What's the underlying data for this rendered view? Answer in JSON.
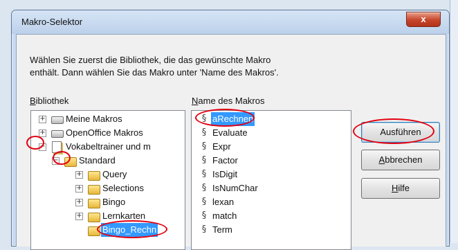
{
  "window": {
    "title": "Makro-Selektor",
    "close_glyph": "x",
    "intro_line1": "Wählen Sie zuerst die Bibliothek, die das gewünschte Makro",
    "intro_line2": "enthält. Dann wählen Sie das Makro unter 'Name des Makros'."
  },
  "library": {
    "label_key": "B",
    "label_rest": "ibliothek",
    "items": [
      {
        "label": "Meine Makros",
        "expander": "+",
        "icon": "drive-icon"
      },
      {
        "label": "OpenOffice Makros",
        "expander": "+",
        "icon": "drive-icon"
      },
      {
        "label": "Vokabeltrainer und m",
        "expander": "−",
        "icon": "document-icon"
      },
      {
        "label": "Standard",
        "expander": "−",
        "icon": "folder-icon"
      },
      {
        "label": "Query",
        "expander": "+",
        "icon": "folder-icon"
      },
      {
        "label": "Selections",
        "expander": "+",
        "icon": "folder-icon"
      },
      {
        "label": "Bingo",
        "expander": "+",
        "icon": "folder-icon"
      },
      {
        "label": "Lernkarten",
        "expander": "+",
        "icon": "folder-icon"
      },
      {
        "label": "Bingo_Rechn",
        "icon": "folder-icon",
        "selected": true
      }
    ]
  },
  "macros": {
    "label_key": "N",
    "label_rest": "ame des Makros",
    "items": [
      {
        "label": "aRechnen",
        "selected": true
      },
      {
        "label": "Evaluate"
      },
      {
        "label": "Expr"
      },
      {
        "label": "Factor"
      },
      {
        "label": "IsDigit"
      },
      {
        "label": "IsNumChar"
      },
      {
        "label": "lexan"
      },
      {
        "label": "match"
      },
      {
        "label": "Term"
      }
    ],
    "icon": "macro-icon"
  },
  "buttons": {
    "run": "Ausführen",
    "cancel_key": "A",
    "cancel_rest": "bbrechen",
    "help_key": "H",
    "help_rest": "ilfe"
  },
  "colors": {
    "selection": "#3399ff",
    "annotation": "#e3000f",
    "close": "#c6452b"
  }
}
